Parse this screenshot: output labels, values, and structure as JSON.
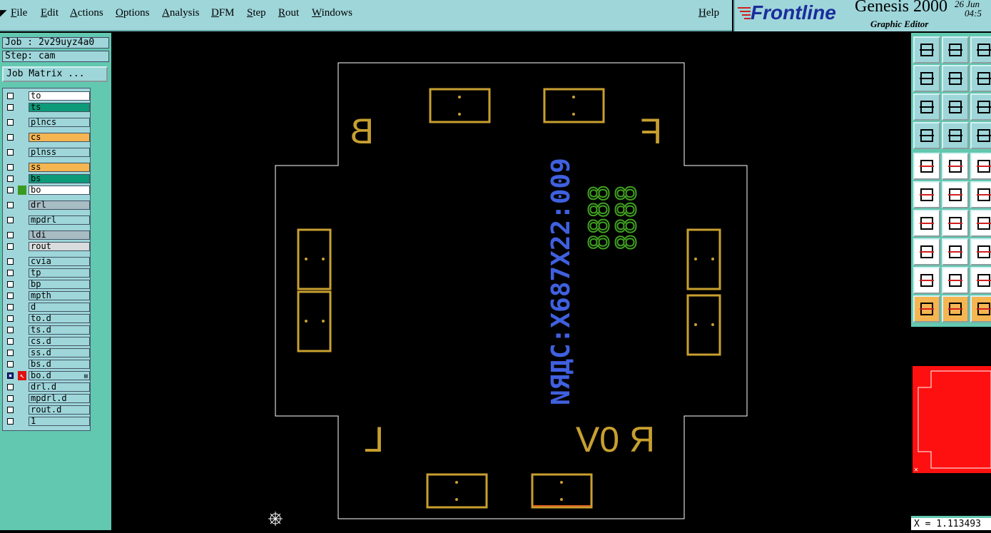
{
  "menu": {
    "items": [
      "File",
      "Edit",
      "Actions",
      "Options",
      "Analysis",
      "DFM",
      "Step",
      "Rout",
      "Windows"
    ],
    "help": "Help"
  },
  "brand": {
    "logo": "Frontline",
    "product": "Genesis 2000",
    "subtitle": "Graphic Editor",
    "date": "26 Jun",
    "time": "04:5"
  },
  "job": {
    "label": "Job : 2v29uyz4a0",
    "step": "Step: cam",
    "matrix_button": "Job Matrix ..."
  },
  "layers": [
    {
      "name": "to",
      "color": "#ffffff",
      "marker": ""
    },
    {
      "name": "ts",
      "color": "#0c9a78",
      "marker": ""
    },
    {
      "name": "plncs",
      "color": "#9ed6da",
      "marker": ""
    },
    {
      "name": "cs",
      "color": "#f5b550",
      "marker": ""
    },
    {
      "name": "plnss",
      "color": "#9ed6da",
      "marker": ""
    },
    {
      "name": "ss",
      "color": "#f5b550",
      "marker": ""
    },
    {
      "name": "bs",
      "color": "#0c9a78",
      "marker": ""
    },
    {
      "name": "bo",
      "color": "#ffffff",
      "marker": "green"
    },
    {
      "name": "drl",
      "color": "#a8bcc4",
      "marker": ""
    },
    {
      "name": "mpdrl",
      "color": "#9ed6da",
      "marker": ""
    },
    {
      "name": "ldi",
      "color": "#a8bcc4",
      "marker": ""
    },
    {
      "name": "rout",
      "color": "#d9dcdc",
      "marker": ""
    },
    {
      "name": "cvia",
      "color": "#9ed6da",
      "marker": ""
    },
    {
      "name": "tp",
      "color": "#9ed6da",
      "marker": ""
    },
    {
      "name": "bp",
      "color": "#9ed6da",
      "marker": ""
    },
    {
      "name": "mpth",
      "color": "#9ed6da",
      "marker": ""
    },
    {
      "name": "d",
      "color": "#9ed6da",
      "marker": ""
    },
    {
      "name": "to.d",
      "color": "#9ed6da",
      "marker": ""
    },
    {
      "name": "ts.d",
      "color": "#9ed6da",
      "marker": ""
    },
    {
      "name": "cs.d",
      "color": "#9ed6da",
      "marker": ""
    },
    {
      "name": "ss.d",
      "color": "#9ed6da",
      "marker": ""
    },
    {
      "name": "bs.d",
      "color": "#9ed6da",
      "marker": ""
    },
    {
      "name": "bo.d",
      "color": "#9ed6da",
      "marker": "arrow",
      "active": true
    },
    {
      "name": "drl.d",
      "color": "#9ed6da",
      "marker": ""
    },
    {
      "name": "mpdrl.d",
      "color": "#9ed6da",
      "marker": ""
    },
    {
      "name": "rout.d",
      "color": "#9ed6da",
      "marker": ""
    },
    {
      "name": "1",
      "color": "#9ed6da",
      "marker": ""
    }
  ],
  "canvas": {
    "letters": {
      "b": "B",
      "f": "F",
      "l": "L",
      "rev": "R 0V"
    },
    "vertical_text": "NЯДC:X687X22:009",
    "digit_columns": [
      "8888",
      "8888"
    ],
    "colors": {
      "board": "#ffffff",
      "pad": "#c8a030",
      "text_blue": "#4060e0",
      "text_green": "#40a020"
    }
  },
  "status": {
    "coordinate": "X = 1.113493"
  }
}
